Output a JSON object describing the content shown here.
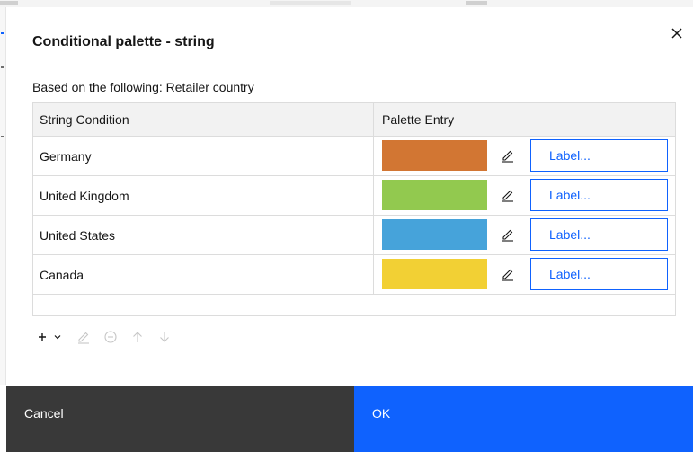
{
  "dialog": {
    "title": "Conditional palette - string",
    "subtitle": "Based on the following: Retailer country",
    "close_icon": "close-icon"
  },
  "table": {
    "headers": [
      "String Condition",
      "Palette Entry"
    ],
    "rows": [
      {
        "condition": "Germany",
        "color": "#d27633",
        "label": "Label..."
      },
      {
        "condition": "United Kingdom",
        "color": "#92c94f",
        "label": "Label..."
      },
      {
        "condition": "United States",
        "color": "#46a3da",
        "label": "Label..."
      },
      {
        "condition": "Canada",
        "color": "#f2d034",
        "label": "Label..."
      }
    ]
  },
  "toolbar": {
    "icons": [
      "add-icon",
      "chevron-down-icon",
      "edit-icon",
      "remove-icon",
      "move-up-icon",
      "move-down-icon"
    ]
  },
  "footer": {
    "cancel_label": "Cancel",
    "ok_label": "OK"
  },
  "colors": {
    "primary": "#0f62fe",
    "secondary_button": "#393939",
    "header_bg": "#f2f2f2",
    "border": "#dcdcdc"
  }
}
